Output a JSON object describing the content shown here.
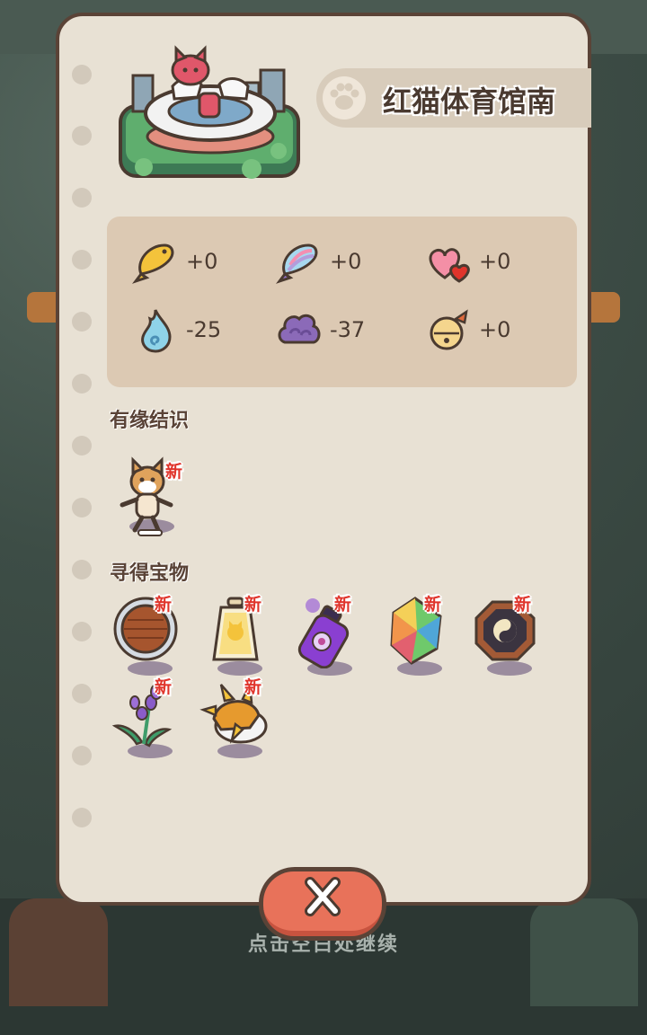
{
  "location": {
    "title": "红猫体育馆南"
  },
  "resources": [
    {
      "icon": "fish-icon",
      "value": "+0"
    },
    {
      "icon": "rainbow-fish-icon",
      "value": "+0"
    },
    {
      "icon": "hearts-icon",
      "value": "+0"
    },
    {
      "icon": "blue-flame-icon",
      "value": "-25"
    },
    {
      "icon": "purple-cloud-icon",
      "value": "-37"
    },
    {
      "icon": "bell-icon",
      "value": "+0"
    }
  ],
  "sections": {
    "friends_title": "有缘结识",
    "treasures_title": "寻得宝物"
  },
  "new_label": "新",
  "friends": [
    {
      "icon": "shiba-dog-icon"
    }
  ],
  "treasures": [
    {
      "icon": "wooden-shield-icon"
    },
    {
      "icon": "cat-lantern-icon"
    },
    {
      "icon": "potion-bottle-icon"
    },
    {
      "icon": "rainbow-crystal-icon"
    },
    {
      "icon": "yinyang-bagua-icon"
    },
    {
      "icon": "lavender-icon"
    },
    {
      "icon": "spiked-cake-icon"
    }
  ],
  "footer": {
    "continue_hint": "点击空白处继续",
    "close_icon": "close-icon"
  },
  "colors": {
    "panel_bg": "#e8e1d4",
    "panel_border": "#5a4337",
    "resource_box": "#dcc9b3",
    "new_badge": "#e0342b",
    "close_button": "#e8725a"
  }
}
